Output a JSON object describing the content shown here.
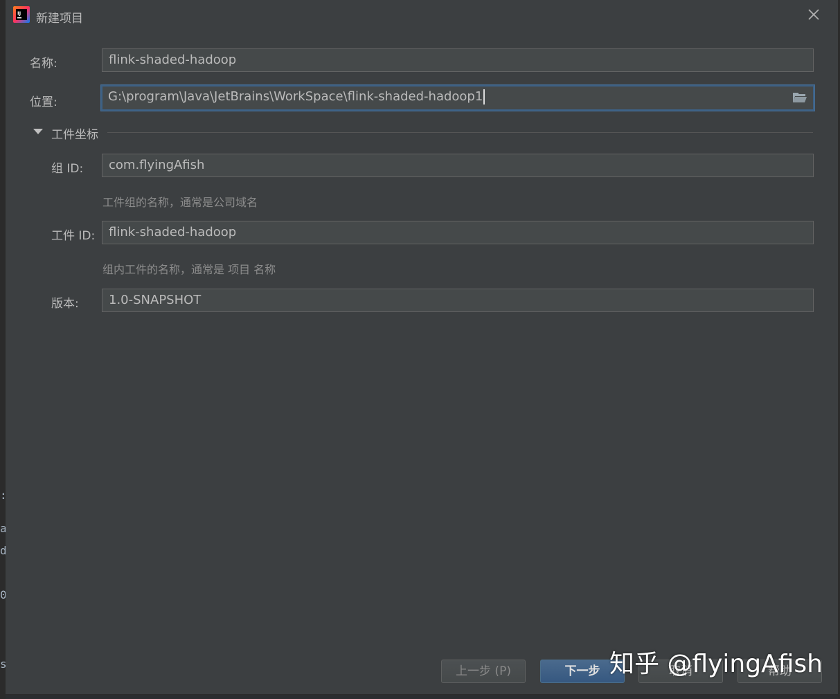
{
  "window": {
    "title": "新建项目"
  },
  "form": {
    "name_label": "名称:",
    "name_value": "flink-shaded-hadoop",
    "location_label": "位置:",
    "location_value": "G:\\program\\Java\\JetBrains\\WorkSpace\\flink-shaded-hadoop1"
  },
  "artifact_coordinates": {
    "section_title": "工件坐标",
    "group_id_label": "组 ID:",
    "group_id_value": "com.flyingAfish",
    "group_id_hint": "工件组的名称，通常是公司域名",
    "artifact_id_label": "工件 ID:",
    "artifact_id_value": "flink-shaded-hadoop",
    "artifact_id_hint": "组内工件的名称，通常是 项目 名称",
    "version_label": "版本:",
    "version_value": "1.0-SNAPSHOT"
  },
  "buttons": {
    "previous": "上一步 (P)",
    "next": "下一步",
    "cancel": "取消",
    "help": "帮助"
  },
  "watermark": "知乎 @flyingAfish",
  "icons": {
    "app": "intellij-idea-icon",
    "close": "close-icon",
    "folder": "folder-open-icon",
    "section_toggle": "triangle-down-icon"
  },
  "colors": {
    "dialog_bg": "#3c3f41",
    "field_bg": "#45494a",
    "focus_border": "#3d6185",
    "primary_button": "#365880"
  }
}
